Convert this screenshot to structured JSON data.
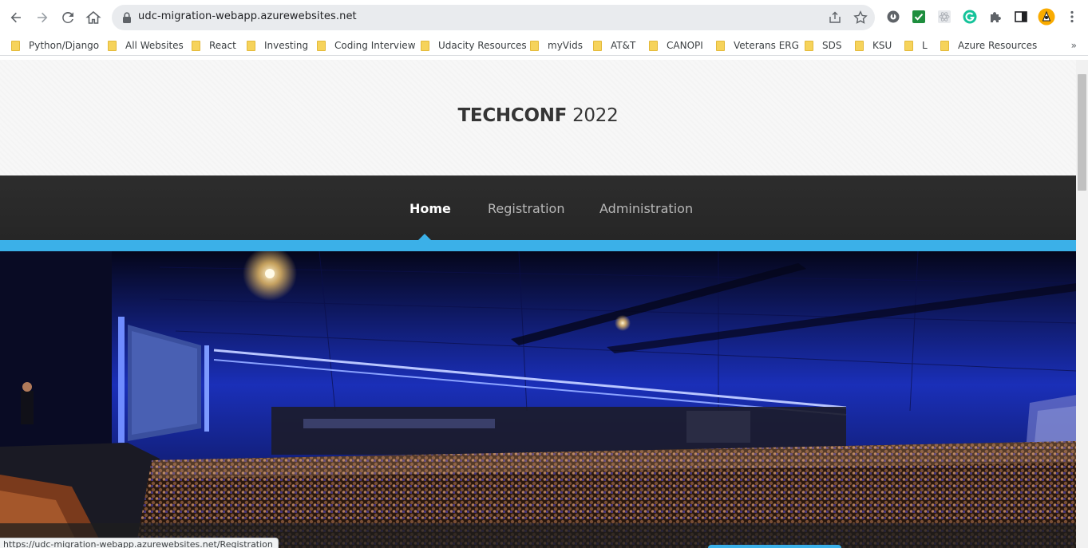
{
  "browser": {
    "url": "udc-migration-webapp.azurewebsites.net",
    "status_url": "https://udc-migration-webapp.azurewebsites.net/Registration",
    "bookmarks": [
      {
        "label": "Python/Django"
      },
      {
        "label": "All Websites"
      },
      {
        "label": "React"
      },
      {
        "label": "Investing"
      },
      {
        "label": "Coding Interview"
      },
      {
        "label": "Udacity Resources"
      },
      {
        "label": "myVids"
      },
      {
        "label": "AT&T"
      },
      {
        "label": "CANOPI"
      },
      {
        "label": "Veterans ERG"
      },
      {
        "label": "SDS"
      },
      {
        "label": "KSU"
      },
      {
        "label": "L"
      },
      {
        "label": "Azure Resources"
      }
    ],
    "more_bookmarks": "»",
    "icons": [
      "back-icon",
      "forward-icon",
      "reload-icon",
      "home-icon",
      "lock-icon",
      "share-icon",
      "star-icon",
      "extension-icon",
      "side-panel-icon",
      "profile-avatar",
      "menu-icon"
    ]
  },
  "site": {
    "title_strong": "TECHCONF",
    "title_light": " 2022",
    "nav": [
      {
        "label": "Home",
        "active": true
      },
      {
        "label": "Registration",
        "active": false
      },
      {
        "label": "Administration",
        "active": false
      }
    ],
    "accent_color": "#3bb0e8"
  }
}
